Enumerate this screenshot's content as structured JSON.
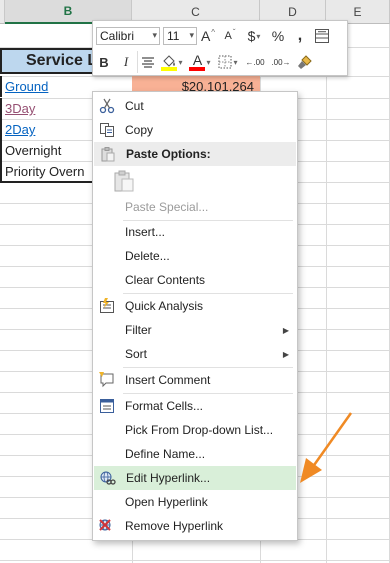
{
  "sheet": {
    "columns": [
      "B",
      "C",
      "D",
      "E"
    ],
    "header_cell": "Service Le",
    "rows": [
      "Ground",
      "3Day",
      "2Day",
      "Overnight",
      "Priority Overn"
    ],
    "price": "$20,101,264"
  },
  "mini_toolbar": {
    "font_name": "Calibri",
    "font_size": "11",
    "grow_font": "A",
    "shrink_font": "A",
    "currency": "$",
    "percent": "%",
    "comma": ",",
    "bold": "B",
    "italic": "I",
    "font_color_letter": "A",
    "dec_increase": "←.00",
    "dec_decrease": ".00→",
    "colors": {
      "fill_yellow": "#ffff00",
      "font_red": "#ff0000"
    }
  },
  "context_menu": {
    "items": [
      {
        "label": "Cut",
        "icon": "scissors-icon"
      },
      {
        "label": "Copy",
        "icon": "copy-icon"
      },
      {
        "label": "Paste Options:",
        "icon": "paste-icon"
      },
      {
        "label": "",
        "icon": "clipboard-icon"
      },
      {
        "label": "Paste Special...",
        "icon": ""
      },
      {
        "label": "Insert...",
        "icon": ""
      },
      {
        "label": "Delete...",
        "icon": ""
      },
      {
        "label": "Clear Contents",
        "icon": ""
      },
      {
        "label": "Quick Analysis",
        "icon": "quick-analysis-icon"
      },
      {
        "label": "Filter",
        "icon": ""
      },
      {
        "label": "Sort",
        "icon": ""
      },
      {
        "label": "Insert Comment",
        "icon": "comment-icon"
      },
      {
        "label": "Format Cells...",
        "icon": "format-cells-icon"
      },
      {
        "label": "Pick From Drop-down List...",
        "icon": ""
      },
      {
        "label": "Define Name...",
        "icon": ""
      },
      {
        "label": "Edit Hyperlink...",
        "icon": "edit-hyperlink-icon"
      },
      {
        "label": "Open Hyperlink",
        "icon": ""
      },
      {
        "label": "Remove Hyperlink",
        "icon": "remove-hyperlink-icon"
      }
    ]
  },
  "annotation": {
    "arrow_color": "#f08a24"
  }
}
